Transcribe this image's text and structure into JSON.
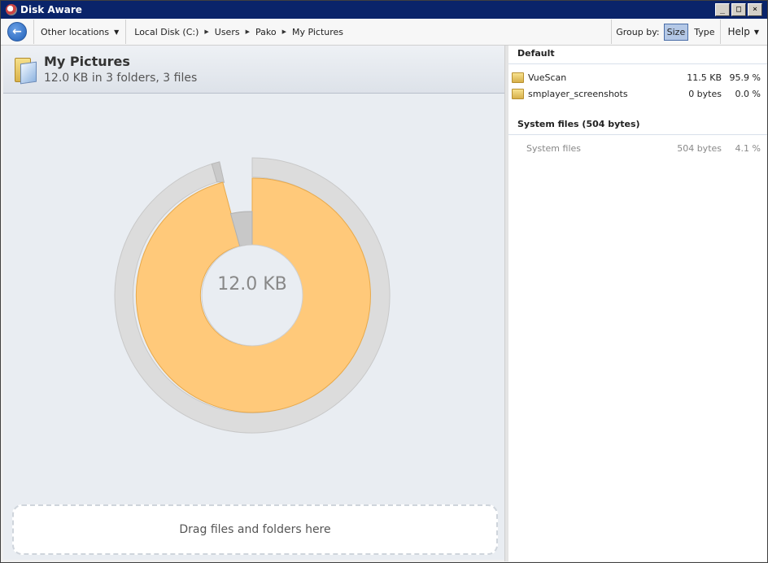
{
  "window": {
    "title": "Disk Aware"
  },
  "toolbar": {
    "other_locations": "Other locations",
    "breadcrumbs": [
      "Local Disk (C:)",
      "Users",
      "Pako",
      "My Pictures"
    ],
    "group_by_label": "Group by:",
    "group_size": "Size",
    "group_type": "Type",
    "help": "Help"
  },
  "header": {
    "folder_name": "My Pictures",
    "summary": "12.0 KB in 3 folders, 3 files"
  },
  "chart": {
    "center_label": "12.0 KB"
  },
  "dropzone": {
    "text": "Drag files and folders here"
  },
  "list": {
    "default_group": "Default",
    "items": [
      {
        "name": "VueScan",
        "size": "11.5 KB",
        "percent": "95.9 %"
      },
      {
        "name": "smplayer_screenshots",
        "size": "0 bytes",
        "percent": "0.0 %"
      }
    ],
    "system_group": "System files (504 bytes)",
    "system_items": [
      {
        "name": "System files",
        "size": "504 bytes",
        "percent": "4.1 %"
      }
    ]
  },
  "colors": {
    "accent_slice": "#ffc97a",
    "title_bar": "#0a246a",
    "selected_button": "#b4c8e6"
  }
}
